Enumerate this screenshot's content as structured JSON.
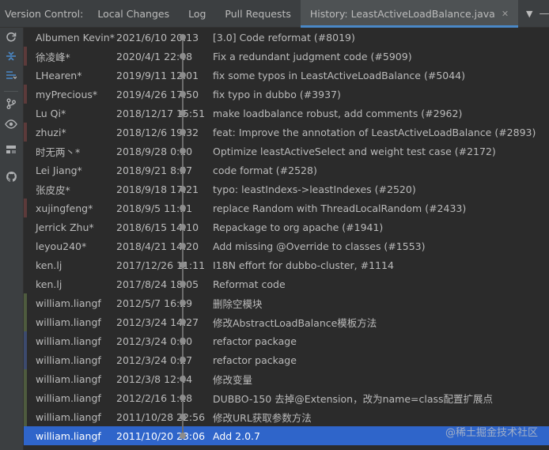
{
  "tabbar": {
    "label": "Version Control:",
    "tabs": [
      {
        "label": "Local Changes"
      },
      {
        "label": "Log"
      },
      {
        "label": "Pull Requests"
      },
      {
        "label": "History: LeastActiveLoadBalance.java"
      }
    ],
    "close_glyph": "✕",
    "menu_glyph": "▼",
    "minimize_glyph": "—"
  },
  "sidebar": {
    "icons": [
      "refresh-icon",
      "collapse-icon",
      "expand-icon",
      "branch-icon",
      "eye-icon",
      "layout-icon",
      "github-icon"
    ]
  },
  "colors": {
    "accent": "#4a88c7",
    "selected_row": "#2f65ca",
    "stripe_green": "#4e5b3e",
    "stripe_red": "#5c3a3a",
    "stripe_blue": "#3c4a6e"
  },
  "history": {
    "commits": [
      {
        "author": "Albumen Kevin*",
        "date": "2021/6/10 20:13",
        "message": "[3.0] Code reformat (#8019)"
      },
      {
        "author": "徐凌峰*",
        "date": "2020/4/1 22:48",
        "message": "Fix a redundant judgment code (#5909)"
      },
      {
        "author": "LHearen*",
        "date": "2019/9/11 12:01",
        "message": "fix some typos in LeastActiveLoadBalance (#5044)"
      },
      {
        "author": "myPrecious*",
        "date": "2019/4/26 17:50",
        "message": "fix typo in dubbo (#3937)"
      },
      {
        "author": "Lu Qi*",
        "date": "2018/12/17 15:51",
        "message": "make loadbalance robust, add comments (#2962)"
      },
      {
        "author": "zhuzi*",
        "date": "2018/12/6 19:32",
        "message": "feat:  Improve the annotation of LeastActiveLoadBalance (#2893)"
      },
      {
        "author": "时无两丶*",
        "date": "2018/9/28 0:10",
        "message": "Optimize leastActiveSelect and weight test case (#2172)"
      },
      {
        "author": "Lei Jiang*",
        "date": "2018/9/21 8:57",
        "message": "code format (#2528)"
      },
      {
        "author": "张皮皮*",
        "date": "2018/9/18 17:21",
        "message": "typo: leastIndexs->leastIndexes (#2520)"
      },
      {
        "author": "xujingfeng*",
        "date": "2018/9/5 11:31",
        "message": "replace Random with ThreadLocalRandom (#2433)"
      },
      {
        "author": "Jerrick Zhu*",
        "date": "2018/6/15 14:10",
        "message": "Repackage to org apache (#1941)"
      },
      {
        "author": "leyou240*",
        "date": "2018/4/21 14:20",
        "message": "Add missing @Override to classes (#1553)"
      },
      {
        "author": "ken.lj",
        "date": "2017/12/26 11:11",
        "message": "I18N effort for dubbo-cluster, #1114"
      },
      {
        "author": "ken.lj",
        "date": "2017/8/24 18:05",
        "message": "Reformat code"
      },
      {
        "author": "william.liangf",
        "date": "2012/5/7 16:29",
        "message": "删除空模块"
      },
      {
        "author": "william.liangf",
        "date": "2012/3/24 14:27",
        "message": "修改AbstractLoadBalance模板方法"
      },
      {
        "author": "william.liangf",
        "date": "2012/3/24 0:30",
        "message": "refactor package"
      },
      {
        "author": "william.liangf",
        "date": "2012/3/24 0:27",
        "message": "refactor package"
      },
      {
        "author": "william.liangf",
        "date": "2012/3/8 12:44",
        "message": "修改变量"
      },
      {
        "author": "william.liangf",
        "date": "2012/2/16 1:18",
        "message": "DUBBO-150 去掉@Extension，改为name=class配置扩展点"
      },
      {
        "author": "william.liangf",
        "date": "2011/10/28 22:56",
        "message": "修改URL获取参数方法"
      },
      {
        "author": "william.liangf",
        "date": "2011/10/20 23:06",
        "message": "Add 2.0.7"
      }
    ]
  },
  "watermark": "@稀土掘金技术社区"
}
